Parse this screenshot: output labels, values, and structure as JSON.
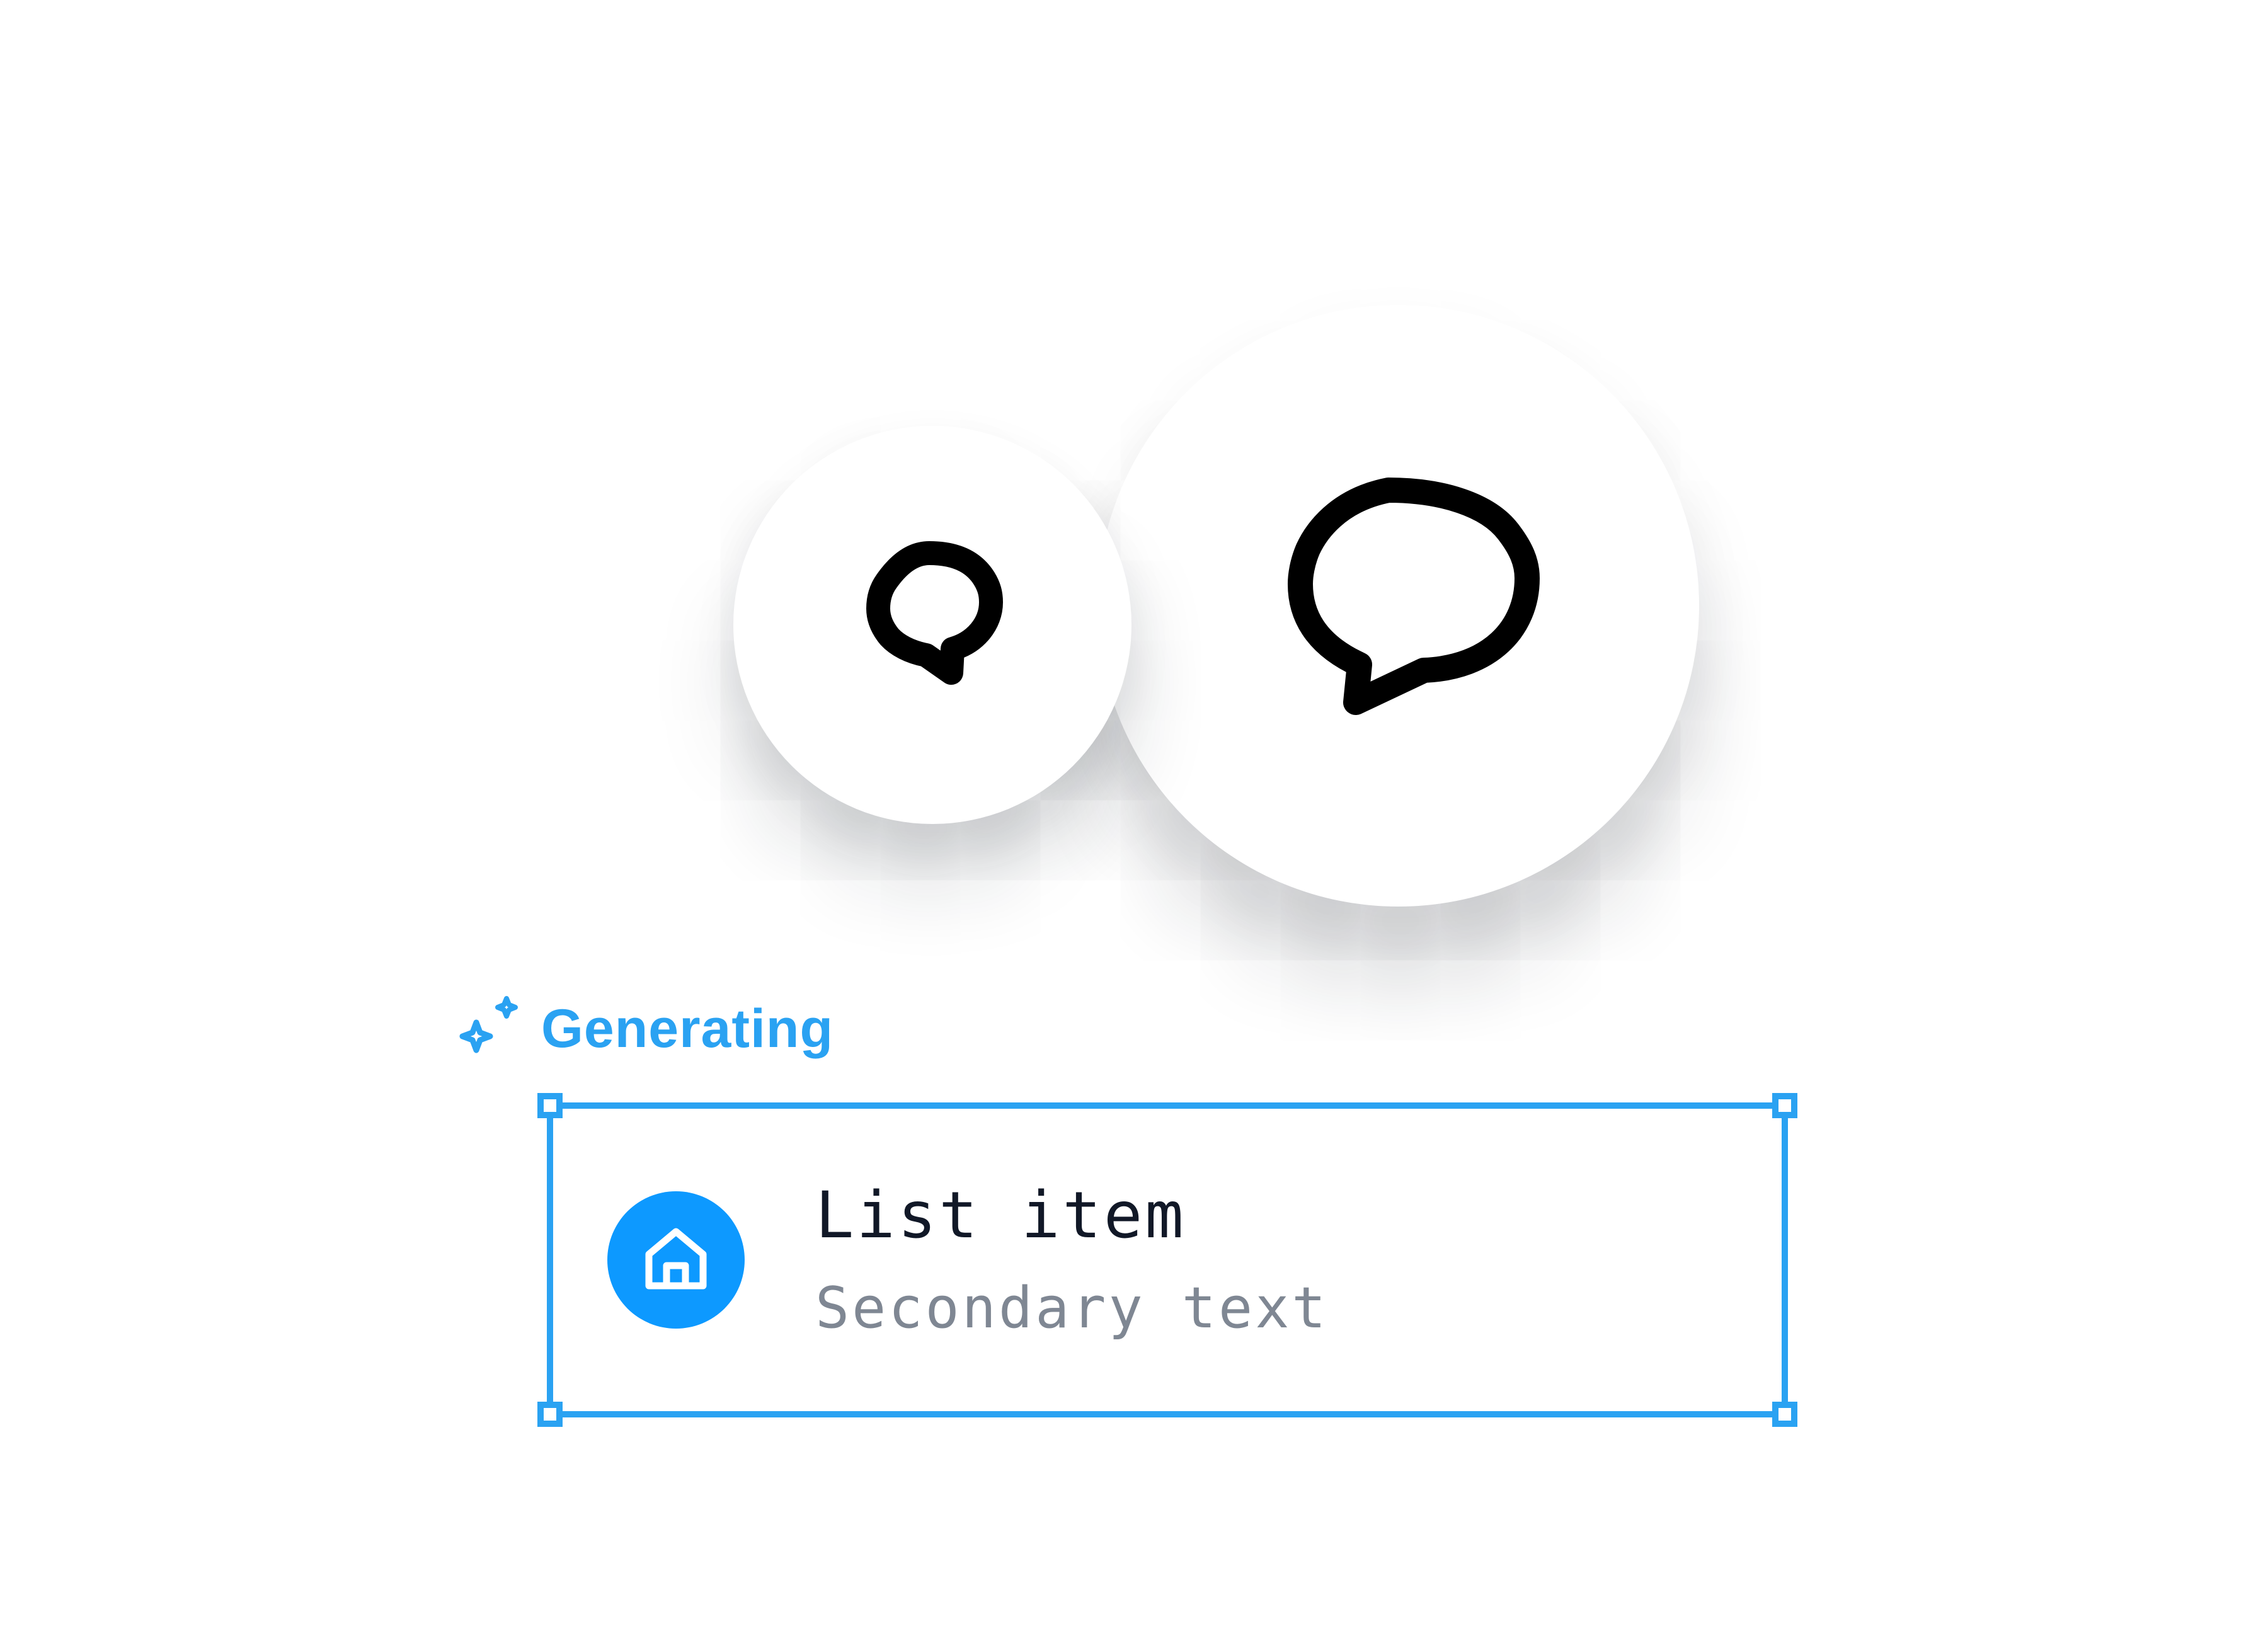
{
  "colors": {
    "accent": "#2aa2f2",
    "avatar_fill": "#0d99ff",
    "primary_text": "#111827",
    "secondary_text": "#7f8793",
    "icon_stroke": "#000000"
  },
  "icons": {
    "small_bubble": "chat-bubble-icon",
    "large_bubble": "chat-bubble-icon",
    "status": "sparkles-icon",
    "avatar": "home-icon"
  },
  "status": {
    "label": "Generating"
  },
  "list_item": {
    "primary": "List item",
    "secondary": "Secondary text"
  }
}
